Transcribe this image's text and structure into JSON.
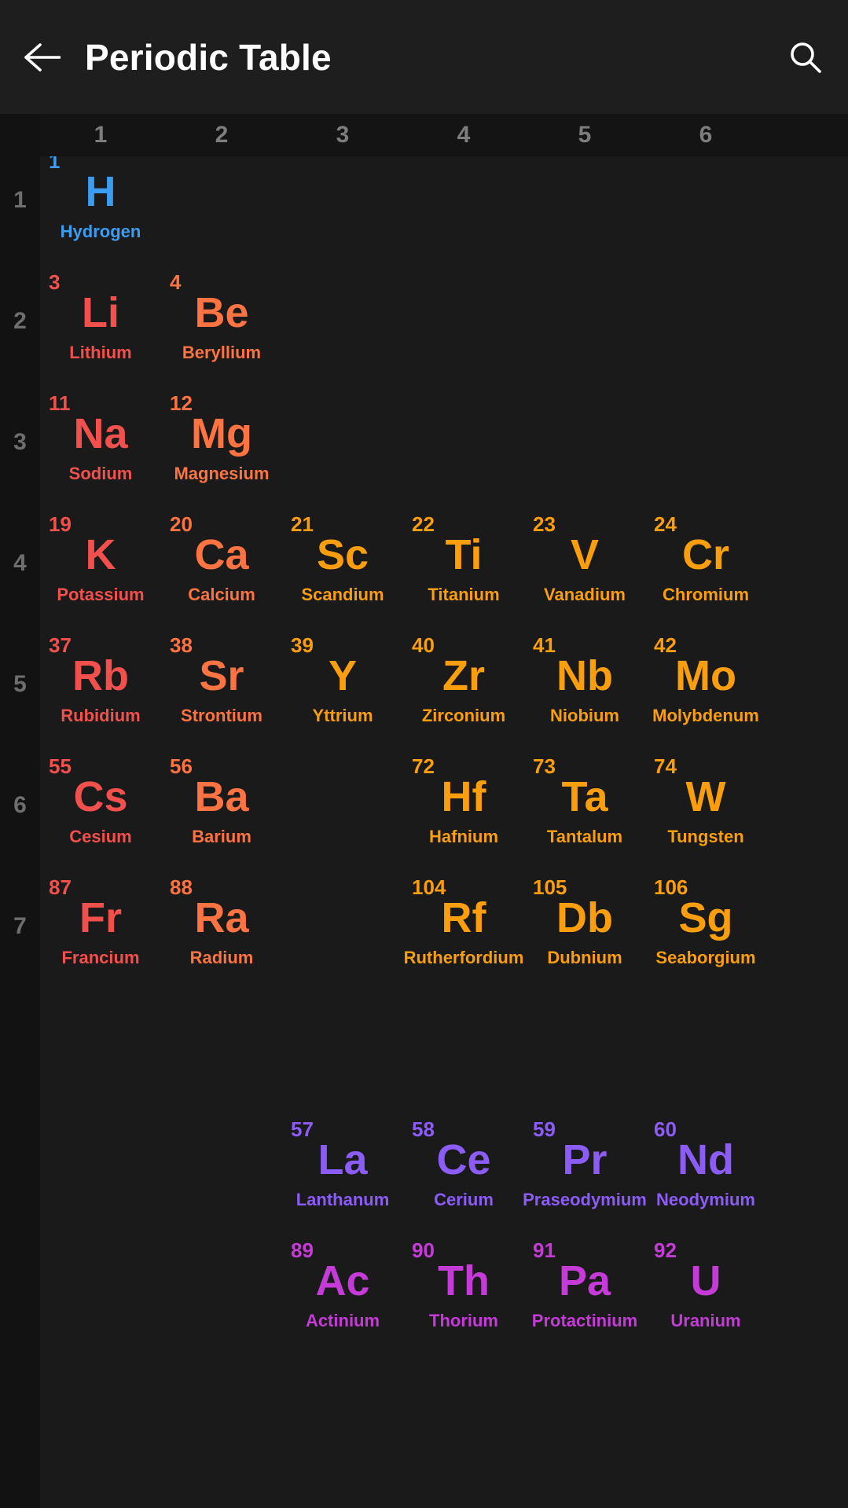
{
  "appbar": {
    "title": "Periodic Table",
    "back_icon": "arrow-left-icon",
    "search_icon": "search-icon"
  },
  "theme": {
    "background": "#121212",
    "appbar_background": "#1e1e1e",
    "grid_background": "#1a1a1a",
    "header_text": "#7d7d7d",
    "title_text": "#ffffff"
  },
  "category_colors": {
    "nonmetal": "#3b9cf0",
    "alkali_metal": "#f2504c",
    "alkaline_earth_metal": "#fd7341",
    "transition_metal": "#fa9e0d",
    "lanthanide": "#8b5cf6",
    "actinide": "#c53bd8"
  },
  "column_headers": [
    "1",
    "2",
    "3",
    "4",
    "5",
    "6"
  ],
  "row_headers": [
    "1",
    "2",
    "3",
    "4",
    "5",
    "6",
    "7"
  ],
  "elements": [
    {
      "number": "1",
      "symbol": "H",
      "name": "Hydrogen",
      "group": 1,
      "period": 1,
      "category": "nonmetal"
    },
    {
      "number": "3",
      "symbol": "Li",
      "name": "Lithium",
      "group": 1,
      "period": 2,
      "category": "alkali_metal"
    },
    {
      "number": "4",
      "symbol": "Be",
      "name": "Beryllium",
      "group": 2,
      "period": 2,
      "category": "alkaline_earth_metal"
    },
    {
      "number": "11",
      "symbol": "Na",
      "name": "Sodium",
      "group": 1,
      "period": 3,
      "category": "alkali_metal"
    },
    {
      "number": "12",
      "symbol": "Mg",
      "name": "Magnesium",
      "group": 2,
      "period": 3,
      "category": "alkaline_earth_metal"
    },
    {
      "number": "19",
      "symbol": "K",
      "name": "Potassium",
      "group": 1,
      "period": 4,
      "category": "alkali_metal"
    },
    {
      "number": "20",
      "symbol": "Ca",
      "name": "Calcium",
      "group": 2,
      "period": 4,
      "category": "alkaline_earth_metal"
    },
    {
      "number": "21",
      "symbol": "Sc",
      "name": "Scandium",
      "group": 3,
      "period": 4,
      "category": "transition_metal"
    },
    {
      "number": "22",
      "symbol": "Ti",
      "name": "Titanium",
      "group": 4,
      "period": 4,
      "category": "transition_metal"
    },
    {
      "number": "23",
      "symbol": "V",
      "name": "Vanadium",
      "group": 5,
      "period": 4,
      "category": "transition_metal"
    },
    {
      "number": "24",
      "symbol": "Cr",
      "name": "Chromium",
      "group": 6,
      "period": 4,
      "category": "transition_metal"
    },
    {
      "number": "37",
      "symbol": "Rb",
      "name": "Rubidium",
      "group": 1,
      "period": 5,
      "category": "alkali_metal"
    },
    {
      "number": "38",
      "symbol": "Sr",
      "name": "Strontium",
      "group": 2,
      "period": 5,
      "category": "alkaline_earth_metal"
    },
    {
      "number": "39",
      "symbol": "Y",
      "name": "Yttrium",
      "group": 3,
      "period": 5,
      "category": "transition_metal"
    },
    {
      "number": "40",
      "symbol": "Zr",
      "name": "Zirconium",
      "group": 4,
      "period": 5,
      "category": "transition_metal"
    },
    {
      "number": "41",
      "symbol": "Nb",
      "name": "Niobium",
      "group": 5,
      "period": 5,
      "category": "transition_metal"
    },
    {
      "number": "42",
      "symbol": "Mo",
      "name": "Molybdenum",
      "group": 6,
      "period": 5,
      "category": "transition_metal"
    },
    {
      "number": "55",
      "symbol": "Cs",
      "name": "Cesium",
      "group": 1,
      "period": 6,
      "category": "alkali_metal"
    },
    {
      "number": "56",
      "symbol": "Ba",
      "name": "Barium",
      "group": 2,
      "period": 6,
      "category": "alkaline_earth_metal"
    },
    {
      "number": "72",
      "symbol": "Hf",
      "name": "Hafnium",
      "group": 4,
      "period": 6,
      "category": "transition_metal"
    },
    {
      "number": "73",
      "symbol": "Ta",
      "name": "Tantalum",
      "group": 5,
      "period": 6,
      "category": "transition_metal"
    },
    {
      "number": "74",
      "symbol": "W",
      "name": "Tungsten",
      "group": 6,
      "period": 6,
      "category": "transition_metal"
    },
    {
      "number": "87",
      "symbol": "Fr",
      "name": "Francium",
      "group": 1,
      "period": 7,
      "category": "alkali_metal"
    },
    {
      "number": "88",
      "symbol": "Ra",
      "name": "Radium",
      "group": 2,
      "period": 7,
      "category": "alkaline_earth_metal"
    },
    {
      "number": "104",
      "symbol": "Rf",
      "name": "Rutherfordium",
      "group": 4,
      "period": 7,
      "category": "transition_metal"
    },
    {
      "number": "105",
      "symbol": "Db",
      "name": "Dubnium",
      "group": 5,
      "period": 7,
      "category": "transition_metal"
    },
    {
      "number": "106",
      "symbol": "Sg",
      "name": "Seaborgium",
      "group": 6,
      "period": 7,
      "category": "transition_metal"
    },
    {
      "number": "57",
      "symbol": "La",
      "name": "Lanthanum",
      "group": 3,
      "period": 9,
      "category": "lanthanide"
    },
    {
      "number": "58",
      "symbol": "Ce",
      "name": "Cerium",
      "group": 4,
      "period": 9,
      "category": "lanthanide"
    },
    {
      "number": "59",
      "symbol": "Pr",
      "name": "Praseodymium",
      "group": 5,
      "period": 9,
      "category": "lanthanide"
    },
    {
      "number": "60",
      "symbol": "Nd",
      "name": "Neodymium",
      "group": 6,
      "period": 9,
      "category": "lanthanide"
    },
    {
      "number": "89",
      "symbol": "Ac",
      "name": "Actinium",
      "group": 3,
      "period": 10,
      "category": "actinide"
    },
    {
      "number": "90",
      "symbol": "Th",
      "name": "Thorium",
      "group": 4,
      "period": 10,
      "category": "actinide"
    },
    {
      "number": "91",
      "symbol": "Pa",
      "name": "Protactinium",
      "group": 5,
      "period": 10,
      "category": "actinide"
    },
    {
      "number": "92",
      "symbol": "U",
      "name": "Uranium",
      "group": 6,
      "period": 10,
      "category": "actinide"
    }
  ]
}
